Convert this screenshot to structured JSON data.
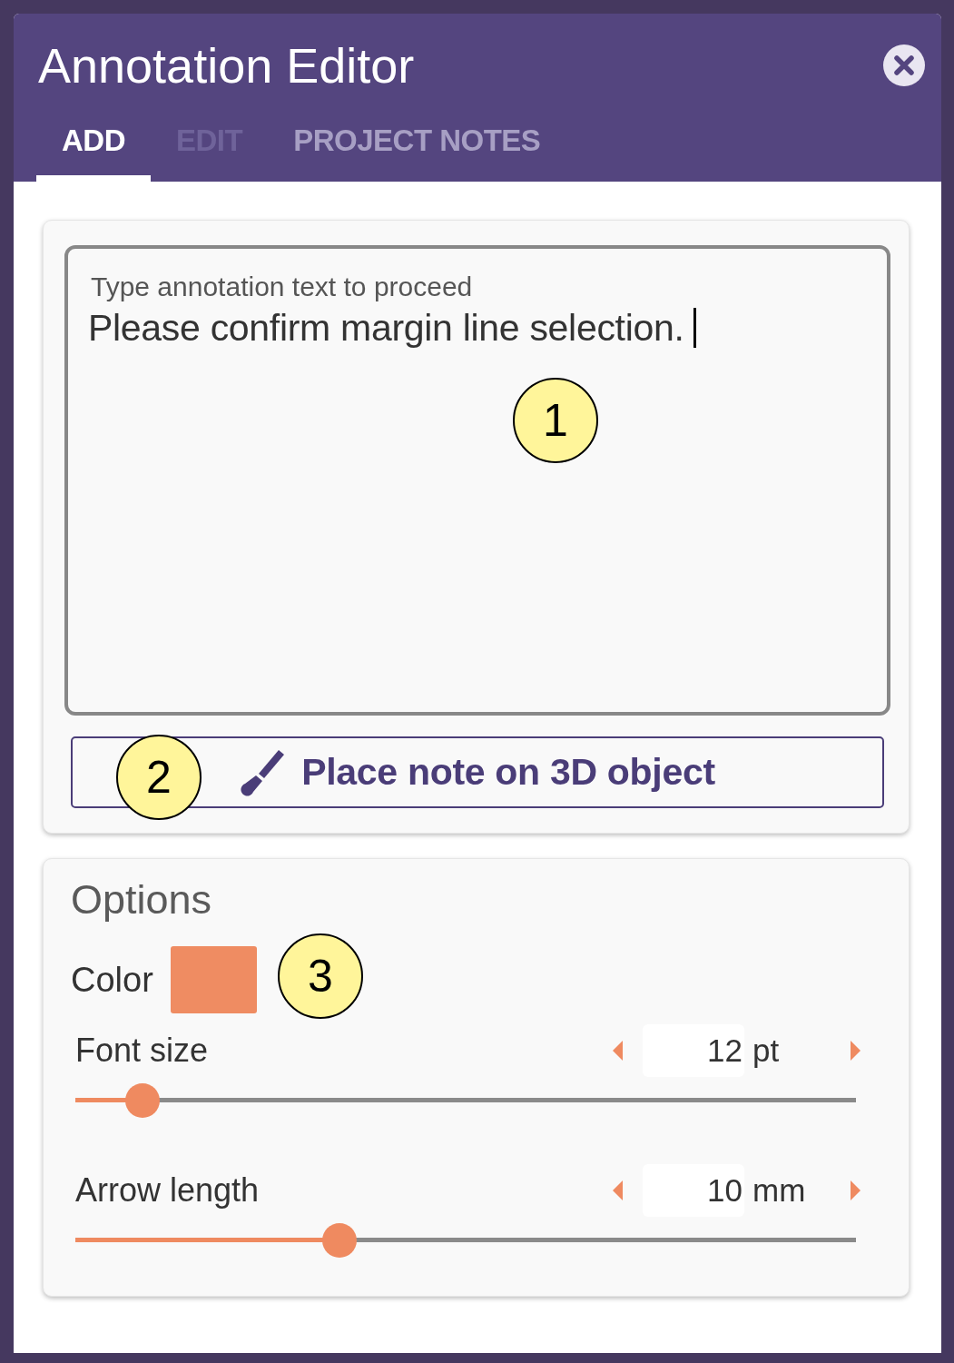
{
  "window": {
    "title": "Annotation Editor"
  },
  "tabs": [
    {
      "label": "ADD",
      "selected": true,
      "disabled": false
    },
    {
      "label": "EDIT",
      "selected": false,
      "disabled": true
    },
    {
      "label": "PROJECT NOTES",
      "selected": false,
      "disabled": false
    }
  ],
  "annotation_field": {
    "label": "Type annotation text to proceed",
    "value": "Please confirm margin line selection.",
    "focused": true,
    "callout": "1"
  },
  "place_button": {
    "label": "Place note on 3D object",
    "callout": "2"
  },
  "options": {
    "title": "Options",
    "color_label": "Color",
    "color": "#ef8c62",
    "callout": "3",
    "sliders": [
      {
        "label": "Font size",
        "value": "12",
        "unit": "pt",
        "level": 0.086
      },
      {
        "label": "Arrow length",
        "value": "10",
        "unit": "mm",
        "level": 0.338
      }
    ]
  }
}
